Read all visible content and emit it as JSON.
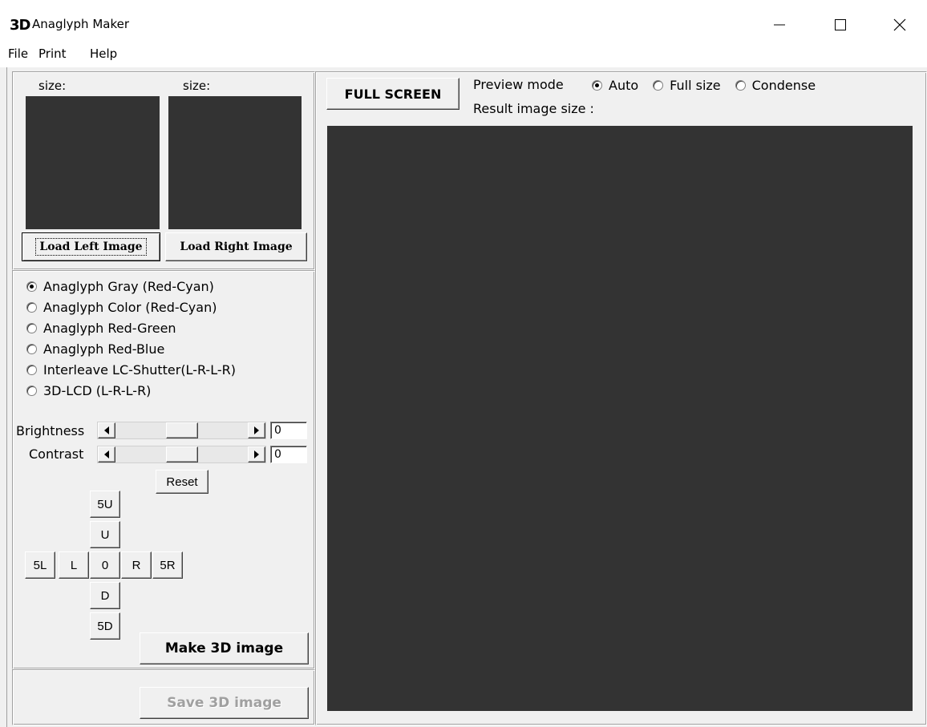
{
  "window": {
    "icon_text": "3D",
    "title": "Anaglyph Maker",
    "controls": {
      "minimize": "—",
      "maximize": "☐",
      "close": "✕"
    }
  },
  "menu": {
    "file": "File",
    "print": "Print",
    "help": "Help"
  },
  "left_image": {
    "size_label": "size:",
    "button": "Load Left Image"
  },
  "right_image": {
    "size_label": "size:",
    "button": "Load Right Image"
  },
  "modes": {
    "items": [
      {
        "label": "Anaglyph Gray (Red-Cyan)",
        "checked": true
      },
      {
        "label": "Anaglyph Color (Red-Cyan)",
        "checked": false
      },
      {
        "label": "Anaglyph Red-Green",
        "checked": false
      },
      {
        "label": "Anaglyph Red-Blue",
        "checked": false
      },
      {
        "label": "Interleave LC-Shutter(L-R-L-R)",
        "checked": false
      },
      {
        "label": "3D-LCD (L-R-L-R)",
        "checked": false
      }
    ]
  },
  "brightness": {
    "label": "Brightness",
    "value": "0",
    "level": 0.5
  },
  "contrast": {
    "label": "Contrast",
    "value": "0",
    "level": 0.5
  },
  "reset_label": "Reset",
  "direction": {
    "up5": "5U",
    "up": "U",
    "left5": "5L",
    "left": "L",
    "center": "0",
    "right": "R",
    "right5": "5R",
    "down": "D",
    "down5": "5D"
  },
  "make_3d_label": "Make 3D image",
  "save_3d_label": "Save 3D image",
  "fullscreen_label": "FULL SCREEN",
  "preview": {
    "label": "Preview mode",
    "options": [
      {
        "label": "Auto",
        "checked": true
      },
      {
        "label": "Full size",
        "checked": false
      },
      {
        "label": "Condense",
        "checked": false
      }
    ]
  },
  "result_size_label": "Result image size :"
}
